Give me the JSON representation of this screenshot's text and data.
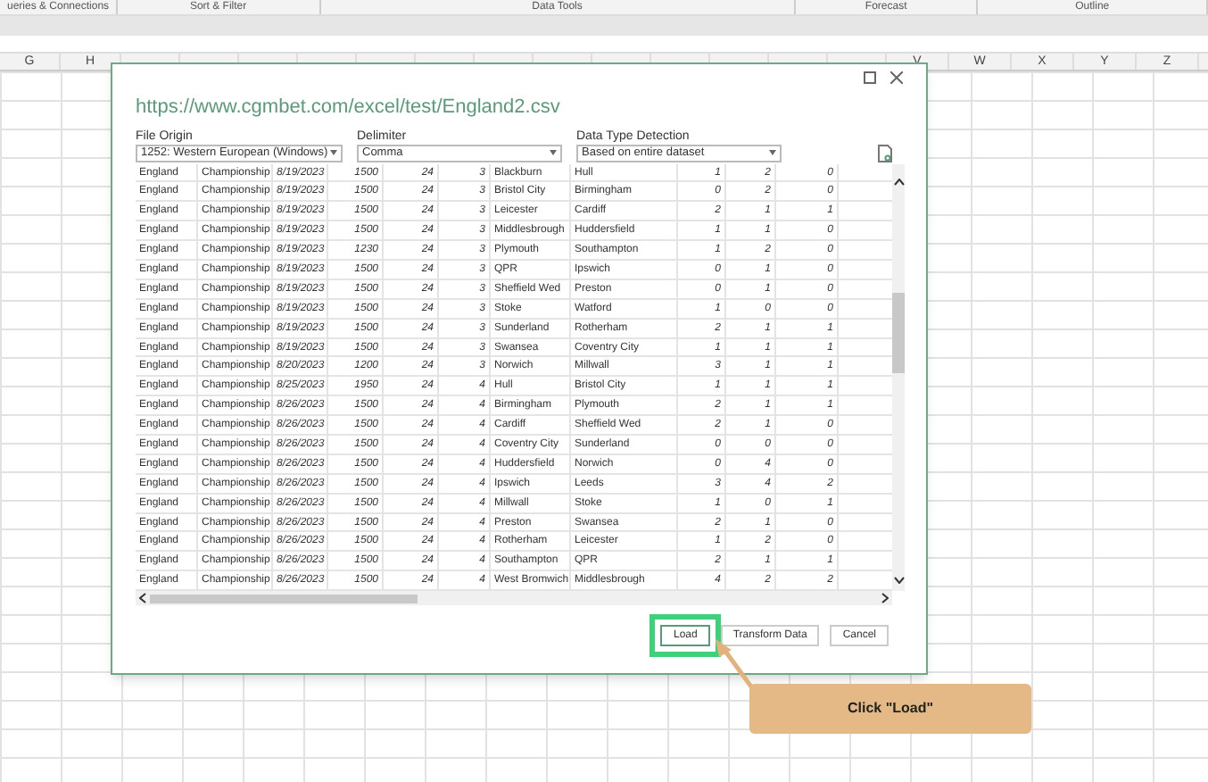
{
  "ribbon_groups": [
    "ueries & Connections",
    "Sort & Filter",
    "Data Tools",
    "Forecast",
    "Outline"
  ],
  "column_headers": {
    "left": [
      "G",
      "H"
    ],
    "right": [
      "V",
      "W",
      "X",
      "Y",
      "Z"
    ]
  },
  "dialog": {
    "title": "https://www.cgmbet.com/excel/test/England2.csv",
    "file_origin": {
      "label": "File Origin",
      "value": "1252: Western European (Windows)"
    },
    "delimiter": {
      "label": "Delimiter",
      "value": "Comma"
    },
    "data_type_detection": {
      "label": "Data Type Detection",
      "value": "Based on entire dataset"
    },
    "rows": [
      [
        "England",
        "Championship",
        "8/19/2023",
        "1500",
        "24",
        "3",
        "Blackburn",
        "Hull",
        "1",
        "2",
        "0"
      ],
      [
        "England",
        "Championship",
        "8/19/2023",
        "1500",
        "24",
        "3",
        "Bristol City",
        "Birmingham",
        "0",
        "2",
        "0"
      ],
      [
        "England",
        "Championship",
        "8/19/2023",
        "1500",
        "24",
        "3",
        "Leicester",
        "Cardiff",
        "2",
        "1",
        "1"
      ],
      [
        "England",
        "Championship",
        "8/19/2023",
        "1500",
        "24",
        "3",
        "Middlesbrough",
        "Huddersfield",
        "1",
        "1",
        "0"
      ],
      [
        "England",
        "Championship",
        "8/19/2023",
        "1230",
        "24",
        "3",
        "Plymouth",
        "Southampton",
        "1",
        "2",
        "0"
      ],
      [
        "England",
        "Championship",
        "8/19/2023",
        "1500",
        "24",
        "3",
        "QPR",
        "Ipswich",
        "0",
        "1",
        "0"
      ],
      [
        "England",
        "Championship",
        "8/19/2023",
        "1500",
        "24",
        "3",
        "Sheffield Wed",
        "Preston",
        "0",
        "1",
        "0"
      ],
      [
        "England",
        "Championship",
        "8/19/2023",
        "1500",
        "24",
        "3",
        "Stoke",
        "Watford",
        "1",
        "0",
        "0"
      ],
      [
        "England",
        "Championship",
        "8/19/2023",
        "1500",
        "24",
        "3",
        "Sunderland",
        "Rotherham",
        "2",
        "1",
        "1"
      ],
      [
        "England",
        "Championship",
        "8/19/2023",
        "1500",
        "24",
        "3",
        "Swansea",
        "Coventry City",
        "1",
        "1",
        "1"
      ],
      [
        "England",
        "Championship",
        "8/20/2023",
        "1200",
        "24",
        "3",
        "Norwich",
        "Millwall",
        "3",
        "1",
        "1"
      ],
      [
        "England",
        "Championship",
        "8/25/2023",
        "1950",
        "24",
        "4",
        "Hull",
        "Bristol City",
        "1",
        "1",
        "1"
      ],
      [
        "England",
        "Championship",
        "8/26/2023",
        "1500",
        "24",
        "4",
        "Birmingham",
        "Plymouth",
        "2",
        "1",
        "1"
      ],
      [
        "England",
        "Championship",
        "8/26/2023",
        "1500",
        "24",
        "4",
        "Cardiff",
        "Sheffield Wed",
        "2",
        "1",
        "0"
      ],
      [
        "England",
        "Championship",
        "8/26/2023",
        "1500",
        "24",
        "4",
        "Coventry City",
        "Sunderland",
        "0",
        "0",
        "0"
      ],
      [
        "England",
        "Championship",
        "8/26/2023",
        "1500",
        "24",
        "4",
        "Huddersfield",
        "Norwich",
        "0",
        "4",
        "0"
      ],
      [
        "England",
        "Championship",
        "8/26/2023",
        "1500",
        "24",
        "4",
        "Ipswich",
        "Leeds",
        "3",
        "4",
        "2"
      ],
      [
        "England",
        "Championship",
        "8/26/2023",
        "1500",
        "24",
        "4",
        "Millwall",
        "Stoke",
        "1",
        "0",
        "1"
      ],
      [
        "England",
        "Championship",
        "8/26/2023",
        "1500",
        "24",
        "4",
        "Preston",
        "Swansea",
        "2",
        "1",
        "0"
      ],
      [
        "England",
        "Championship",
        "8/26/2023",
        "1500",
        "24",
        "4",
        "Rotherham",
        "Leicester",
        "1",
        "2",
        "0"
      ],
      [
        "England",
        "Championship",
        "8/26/2023",
        "1500",
        "24",
        "4",
        "Southampton",
        "QPR",
        "2",
        "1",
        "1"
      ],
      [
        "England",
        "Championship",
        "8/26/2023",
        "1500",
        "24",
        "4",
        "West Bromwich",
        "Middlesbrough",
        "4",
        "2",
        "2"
      ]
    ],
    "buttons": [
      {
        "label": "Load",
        "selected": true
      },
      {
        "label": "Transform Data",
        "selected": false
      },
      {
        "label": "Cancel",
        "selected": false
      }
    ]
  },
  "callout": {
    "text": "Click \"Load\""
  }
}
